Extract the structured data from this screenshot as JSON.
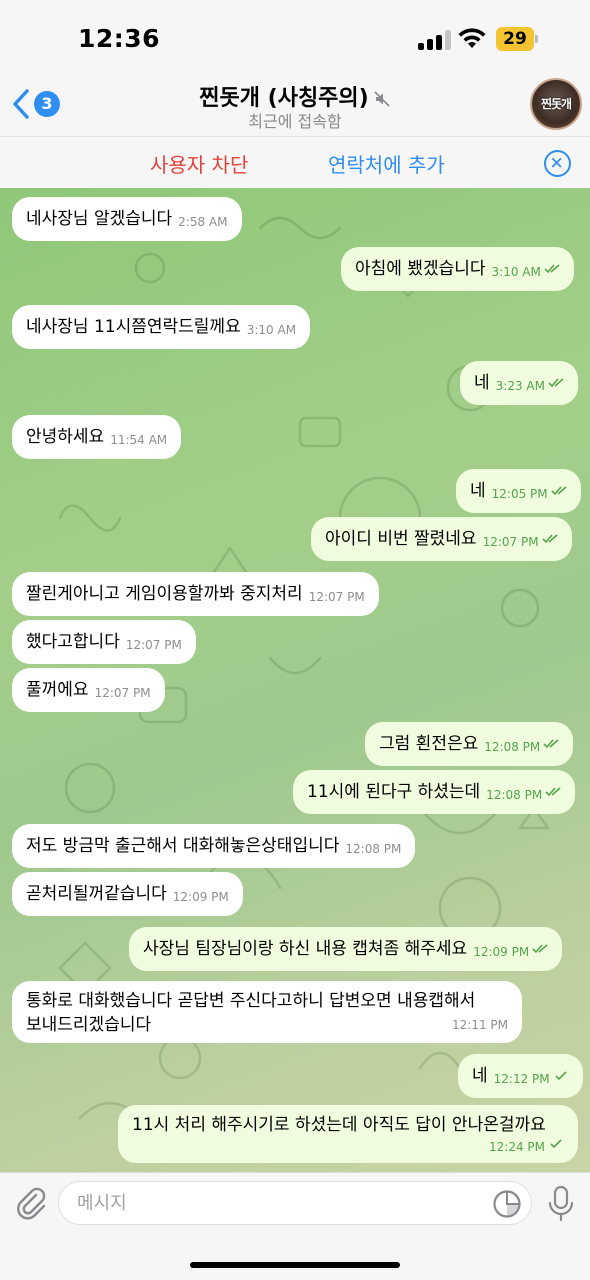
{
  "status_bar": {
    "time": "12:36",
    "battery": "29"
  },
  "header": {
    "back_count": "3",
    "title": "찐돗개 (사칭주의)",
    "subtitle": "최근에 접속함",
    "avatar_text": "찐돗개"
  },
  "actions": {
    "block": "사용자 차단",
    "add_contact": "연락처에 추가"
  },
  "colors": {
    "accent": "#2f8ef0",
    "danger": "#e5423b",
    "out_bubble": "#effdde",
    "in_bubble": "#ffffff",
    "read_check": "#58a34e"
  },
  "messages": [
    {
      "text": "네사장님 알겠습니다",
      "time": "2:58 AM"
    },
    {
      "text": "아침에 뵀겠습니다",
      "time": "3:10 AM"
    },
    {
      "text": "네사장님 11시쯤연락드릴께요",
      "time": "3:10 AM"
    },
    {
      "text": "네",
      "time": "3:23 AM"
    },
    {
      "text": "안녕하세요",
      "time": "11:54 AM"
    },
    {
      "text": "네",
      "time": "12:05 PM"
    },
    {
      "text": "아이디 비번 짤렸네요",
      "time": "12:07 PM"
    },
    {
      "text": "짤린게아니고 게임이용할까봐 중지처리",
      "time": "12:07 PM"
    },
    {
      "text": "했다고합니다",
      "time": "12:07 PM"
    },
    {
      "text": "풀꺼에요",
      "time": "12:07 PM"
    },
    {
      "text": "그럼 횐전은요",
      "time": "12:08 PM"
    },
    {
      "text": "11시에 된다구 하셨는데",
      "time": "12:08 PM"
    },
    {
      "text": "저도 방금막 출근해서 대화해놓은상태입니다",
      "time": "12:08 PM"
    },
    {
      "text": "곧처리될꺼같습니다",
      "time": "12:09 PM"
    },
    {
      "text": "사장님 팀장님이랑 하신 내용 캡쳐좀 해주세요",
      "time": "12:09 PM"
    },
    {
      "line1": "통화로 대화했습니다 곧답변 주신다고하니 답변오면 내용캡해서",
      "line2": "보내드리겠습니다",
      "time": "12:11 PM"
    },
    {
      "text": "네",
      "time": "12:12 PM"
    },
    {
      "text": "11시 처리 해주시기로 하셨는데 아직도 답이 안나온걸까요",
      "time": "12:24 PM"
    }
  ],
  "input": {
    "placeholder": "메시지"
  }
}
